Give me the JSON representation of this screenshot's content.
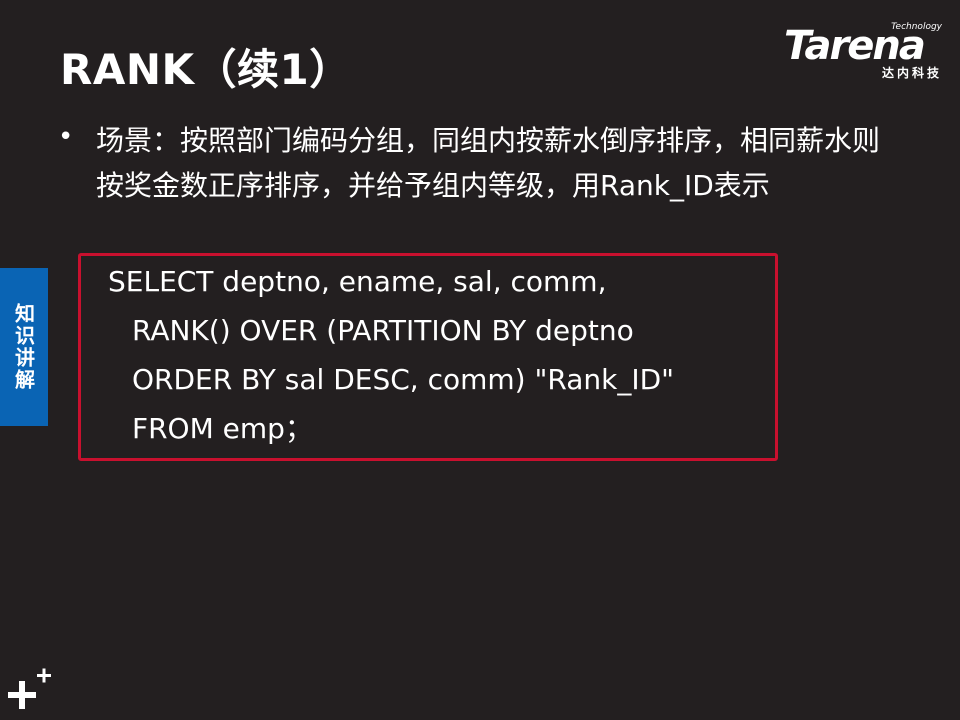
{
  "slide": {
    "title": "RANK（续1）"
  },
  "logo": {
    "small": "Technology",
    "main": "Tarena",
    "sub": "达内科技"
  },
  "bullet": {
    "dot": "•",
    "text": "场景：按照部门编码分组，同组内按薪水倒序排序，相同薪水则按奖金数正序排序，并给予组内等级，用Rank_ID表示"
  },
  "side_tab": {
    "label": "知识讲解"
  },
  "code": {
    "lines": [
      "SELECT deptno, ename, sal, comm,",
      "RANK() OVER (PARTITION BY deptno",
      "ORDER BY sal DESC, comm) \"Rank_ID\"",
      "FROM emp；"
    ],
    "border_color": "#c8102e"
  },
  "colors": {
    "background": "#231f20",
    "tab": "#0a64b4"
  }
}
